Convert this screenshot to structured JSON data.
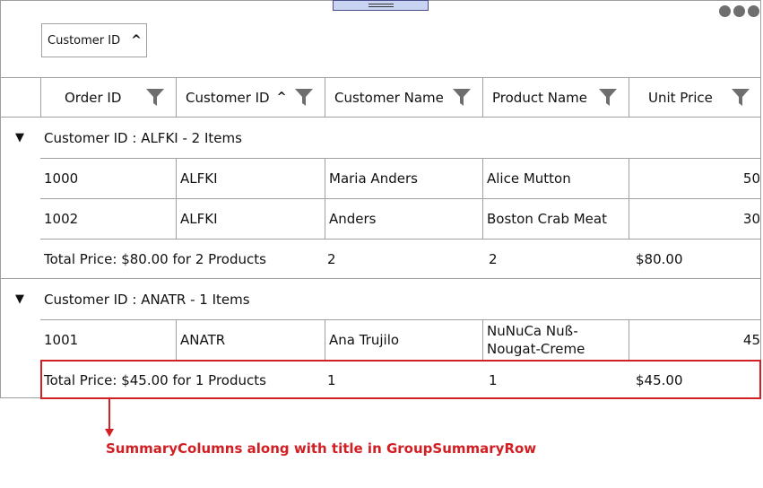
{
  "group_drop_area": {
    "chip_label": "Customer ID"
  },
  "columns": [
    {
      "label": "Order ID",
      "sorted": false
    },
    {
      "label": "Customer ID",
      "sorted": true
    },
    {
      "label": "Customer Name",
      "sorted": false
    },
    {
      "label": "Product Name",
      "sorted": false
    },
    {
      "label": "Unit Price",
      "sorted": false
    }
  ],
  "groups": [
    {
      "caption": "Customer ID : ALFKI - 2 Items",
      "rows": [
        {
          "order_id": "1000",
          "customer_id": "ALFKI",
          "customer_name": "Maria Anders",
          "product_name": "Alice Mutton",
          "unit_price": "50"
        },
        {
          "order_id": "1002",
          "customer_id": "ALFKI",
          "customer_name": "Anders",
          "product_name": "Boston Crab Meat",
          "unit_price": "30"
        }
      ],
      "summary": {
        "title": "Total Price:  $80.00 for  2 Products",
        "customer_name": "2",
        "product_name": "2",
        "unit_price": "$80.00"
      }
    },
    {
      "caption": "Customer ID : ANATR - 1 Items",
      "rows": [
        {
          "order_id": "1001",
          "customer_id": "ANATR",
          "customer_name": "Ana Trujilo",
          "product_name": "NuNuCa Nuß-Nougat-Creme",
          "unit_price": "45"
        }
      ],
      "summary": {
        "title": "Total Price:  $45.00 for  1 Products",
        "customer_name": "1",
        "product_name": "1",
        "unit_price": "$45.00"
      }
    }
  ],
  "annotation": {
    "text": "SummaryColumns along with title in GroupSummaryRow",
    "color": "#d21f24"
  }
}
